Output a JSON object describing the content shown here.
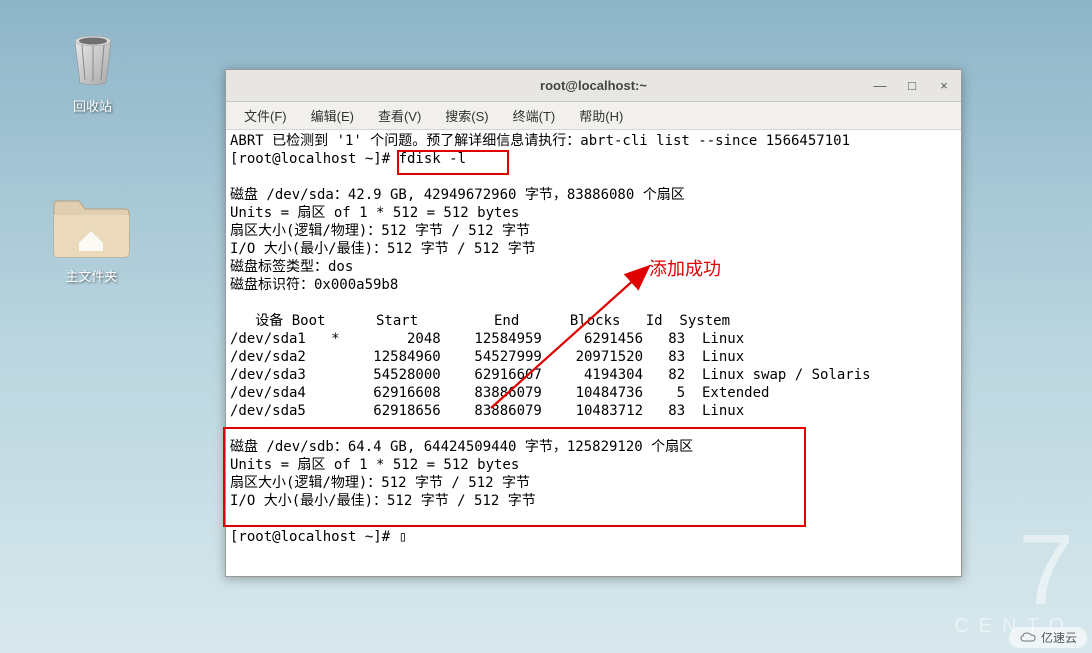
{
  "desktop": {
    "trash_label": "回收站",
    "home_label": "主文件夹"
  },
  "window": {
    "title": "root@localhost:~",
    "controls": {
      "min": "—",
      "max": "□",
      "close": "×"
    }
  },
  "menubar": {
    "items": [
      "文件(F)",
      "编辑(E)",
      "查看(V)",
      "搜索(S)",
      "终端(T)",
      "帮助(H)"
    ]
  },
  "terminal": {
    "line_abrt": "ABRT 已检测到 '1' 个问题。预了解详细信息请执行：abrt-cli list --since 1566457101",
    "line_prompt1": "[root@localhost ~]# fdisk -l",
    "blank": "",
    "disk_sda": "磁盘 /dev/sda：42.9 GB, 42949672960 字节，83886080 个扇区",
    "units_a": "Units = 扇区 of 1 * 512 = 512 bytes",
    "sector_a": "扇区大小(逻辑/物理)：512 字节 / 512 字节",
    "io_a": "I/O 大小(最小/最佳)：512 字节 / 512 字节",
    "label_type": "磁盘标签类型：dos",
    "disk_id": "磁盘标识符：0x000a59b8",
    "header": "   设备 Boot      Start         End      Blocks   Id  System",
    "p1": "/dev/sda1   *        2048    12584959     6291456   83  Linux",
    "p2": "/dev/sda2        12584960    54527999    20971520   83  Linux",
    "p3": "/dev/sda3        54528000    62916607     4194304   82  Linux swap / Solaris",
    "p4": "/dev/sda4        62916608    83886079    10484736    5  Extended",
    "p5": "/dev/sda5        62918656    83886079    10483712   83  Linux",
    "disk_sdb": "磁盘 /dev/sdb：64.4 GB, 64424509440 字节，125829120 个扇区",
    "units_b": "Units = 扇区 of 1 * 512 = 512 bytes",
    "sector_b": "扇区大小(逻辑/物理)：512 字节 / 512 字节",
    "io_b": "I/O 大小(最小/最佳)：512 字节 / 512 字节",
    "line_prompt2": "[root@localhost ~]# ",
    "cursor": "▯"
  },
  "annotation": {
    "text": "添加成功"
  },
  "overlay": {
    "big": "7",
    "text": "CENTO"
  },
  "watermark": {
    "text": "亿速云"
  }
}
